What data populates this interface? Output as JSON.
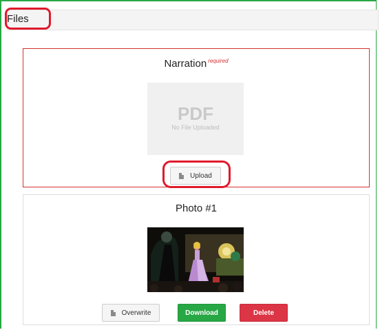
{
  "header": {
    "title": "Files"
  },
  "narration": {
    "title": "Narration",
    "required_label": "required",
    "placeholder_type": "PDF",
    "placeholder_text": "No File Uploaded",
    "upload_label": "Upload"
  },
  "photo": {
    "title": "Photo #1",
    "overwrite_label": "Overwrite",
    "download_label": "Download",
    "delete_label": "Delete"
  },
  "colors": {
    "frame_border": "#27a844",
    "highlight": "#e0192b",
    "required": "#d32f2f",
    "download": "#28a745",
    "delete": "#dc3545"
  },
  "icons": {
    "upload": "file-icon",
    "overwrite": "file-icon"
  }
}
